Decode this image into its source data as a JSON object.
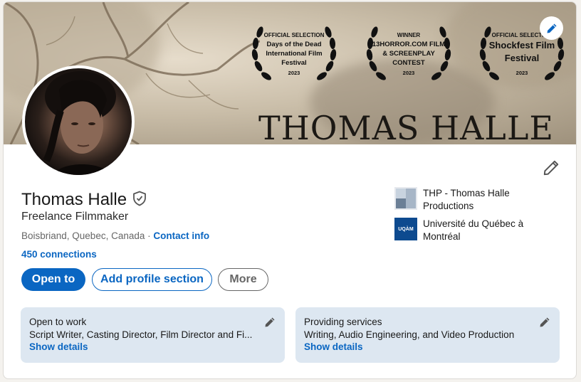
{
  "banner": {
    "laurels": [
      {
        "top": "OFFICIAL SELECTION",
        "mid": "Days of the Dead International Film Festival",
        "year": "2023"
      },
      {
        "top": "WINNER",
        "mid": "13HORROR.COM FILM & SCREENPLAY CONTEST",
        "year": "2023"
      },
      {
        "top": "OFFICIAL SELECTION",
        "mid": "Shockfest Film Festival",
        "year": "2023"
      }
    ],
    "title": "THOMAS HALLE",
    "edit_icon": "pencil-icon"
  },
  "profile": {
    "name": "Thomas Halle",
    "verified_icon": "shield-check-icon",
    "headline": "Freelance Filmmaker",
    "location": "Boisbriand, Quebec, Canada",
    "location_separator": " · ",
    "contact_info": "Contact info",
    "connections": "450 connections",
    "edit_icon": "pencil-icon"
  },
  "actions": {
    "open_to": "Open to",
    "add_section": "Add profile section",
    "more": "More"
  },
  "organizations": [
    {
      "name": "THP - Thomas Halle Productions",
      "logo": "thp-logo"
    },
    {
      "name": "Université du Québec à Montréal",
      "logo_text": "UQÀM"
    }
  ],
  "panels": [
    {
      "title": "Open to work",
      "subtitle": "Script Writer, Casting Director, Film Director and Fi...",
      "link": "Show details"
    },
    {
      "title": "Providing services",
      "subtitle": "Writing, Audio Engineering, and Video Production",
      "link": "Show details"
    }
  ],
  "colors": {
    "accent": "#0a66c2",
    "panel_bg": "#dde7f1",
    "uqam_blue": "#0d4a8f"
  }
}
